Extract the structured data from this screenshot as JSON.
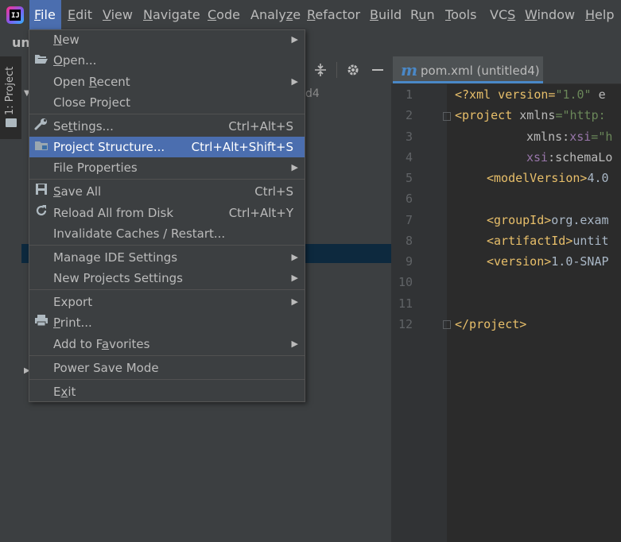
{
  "menubar": {
    "logo": "intellij-logo-icon",
    "items": [
      {
        "label": "File",
        "mnemonic": "F",
        "rest": "ile"
      },
      {
        "label": "Edit",
        "mnemonic": "E",
        "rest": "dit"
      },
      {
        "label": "View",
        "mnemonic": "V",
        "rest": "iew"
      },
      {
        "label": "Navigate",
        "mnemonic": "N",
        "rest": "avigate"
      },
      {
        "label": "Code",
        "mnemonic": "C",
        "rest": "ode"
      },
      {
        "label": "Analyze",
        "pre": "Analy",
        "mnemonic": "z",
        "rest": "e"
      },
      {
        "label": "Refactor",
        "mnemonic": "R",
        "rest": "efactor"
      },
      {
        "label": "Build",
        "mnemonic": "B",
        "rest": "uild"
      },
      {
        "label": "Run",
        "pre": "R",
        "mnemonic": "u",
        "rest": "n"
      },
      {
        "label": "Tools",
        "mnemonic": "T",
        "rest": "ools"
      },
      {
        "label": "VCS",
        "pre": "VC",
        "mnemonic": "S",
        "rest": ""
      },
      {
        "label": "Window",
        "mnemonic": "W",
        "rest": "indow"
      },
      {
        "label": "Help",
        "mnemonic": "H",
        "rest": "elp"
      }
    ]
  },
  "navbar": {
    "project_name_partial": "unt"
  },
  "tool_stripe": {
    "project_tab_label": "1: Project"
  },
  "project_panel": {
    "partial_module_name": "d4"
  },
  "editor": {
    "tab_title": "pom.xml (untitled4)",
    "tab_icon": "maven-icon",
    "line_numbers": [
      "1",
      "2",
      "3",
      "4",
      "5",
      "6",
      "7",
      "8",
      "9",
      "10",
      "11",
      "12"
    ],
    "lines": {
      "l1_a": "<?xml version=",
      "l1_b": "\"1.0\"",
      "l1_c": " e",
      "l2_a": "<project ",
      "l2_b": "xmlns",
      "l2_c": "=",
      "l2_d": "\"http:",
      "l3_a": "xmlns",
      "l3_b": ":",
      "l3_c": "xsi",
      "l3_d": "=",
      "l3_e": "\"h",
      "l4_a": "xsi",
      "l4_b": ":schemaLo",
      "l5_a": "<modelVersion>",
      "l5_b": "4.0",
      "l7_a": "<groupId>",
      "l7_b": "org.exam",
      "l8_a": "<artifactId>",
      "l8_b": "untit",
      "l9_a": "<version>",
      "l9_b": "1.0-SNAP",
      "l12_a": "</project>"
    }
  },
  "file_menu": {
    "items": [
      {
        "pre": "",
        "mn": "N",
        "rest": "ew",
        "shortcut": "",
        "submenu": true,
        "icon": ""
      },
      {
        "pre": "",
        "mn": "O",
        "rest": "pen...",
        "shortcut": "",
        "submenu": false,
        "icon": "open-folder-icon"
      },
      {
        "pre": "Open ",
        "mn": "R",
        "rest": "ecent",
        "shortcut": "",
        "submenu": true,
        "icon": ""
      },
      {
        "pre": "Close Project",
        "mn": "",
        "rest": "",
        "shortcut": "",
        "submenu": false,
        "icon": ""
      },
      {
        "pre": "Se",
        "mn": "t",
        "rest": "tings...",
        "shortcut": "Ctrl+Alt+S",
        "submenu": false,
        "icon": "wrench-icon"
      },
      {
        "pre": "Project Structure...",
        "mn": "",
        "rest": "",
        "shortcut": "Ctrl+Alt+Shift+S",
        "submenu": false,
        "icon": "project-structure-icon"
      },
      {
        "pre": "File Properties",
        "mn": "",
        "rest": "",
        "shortcut": "",
        "submenu": true,
        "icon": ""
      },
      {
        "pre": "",
        "mn": "S",
        "rest": "ave All",
        "shortcut": "Ctrl+S",
        "submenu": false,
        "icon": "save-icon"
      },
      {
        "pre": "Reload All from Disk",
        "mn": "",
        "rest": "",
        "shortcut": "Ctrl+Alt+Y",
        "submenu": false,
        "icon": "reload-icon"
      },
      {
        "pre": "Invalidate Caches / Restart...",
        "mn": "",
        "rest": "",
        "shortcut": "",
        "submenu": false,
        "icon": ""
      },
      {
        "pre": "Manage IDE Settings",
        "mn": "",
        "rest": "",
        "shortcut": "",
        "submenu": true,
        "icon": ""
      },
      {
        "pre": "New Projects Settings",
        "mn": "",
        "rest": "",
        "shortcut": "",
        "submenu": true,
        "icon": ""
      },
      {
        "pre": "Export",
        "mn": "",
        "rest": "",
        "shortcut": "",
        "submenu": true,
        "icon": ""
      },
      {
        "pre": "",
        "mn": "P",
        "rest": "rint...",
        "shortcut": "",
        "submenu": false,
        "icon": "print-icon"
      },
      {
        "pre": "Add to F",
        "mn": "a",
        "rest": "vorites",
        "shortcut": "",
        "submenu": true,
        "icon": ""
      },
      {
        "pre": "Power Save Mode",
        "mn": "",
        "rest": "",
        "shortcut": "",
        "submenu": false,
        "icon": ""
      },
      {
        "pre": "E",
        "mn": "x",
        "rest": "it",
        "shortcut": "",
        "submenu": false,
        "icon": ""
      }
    ],
    "highlighted_index": 5
  },
  "colors": {
    "menu_bg": "#3c3f41",
    "highlight": "#4b6eaf",
    "editor_bg": "#2b2b2b",
    "xml_tag": "#e8bf6a",
    "xml_string": "#6a8759",
    "xml_namespace": "#9876aa"
  }
}
